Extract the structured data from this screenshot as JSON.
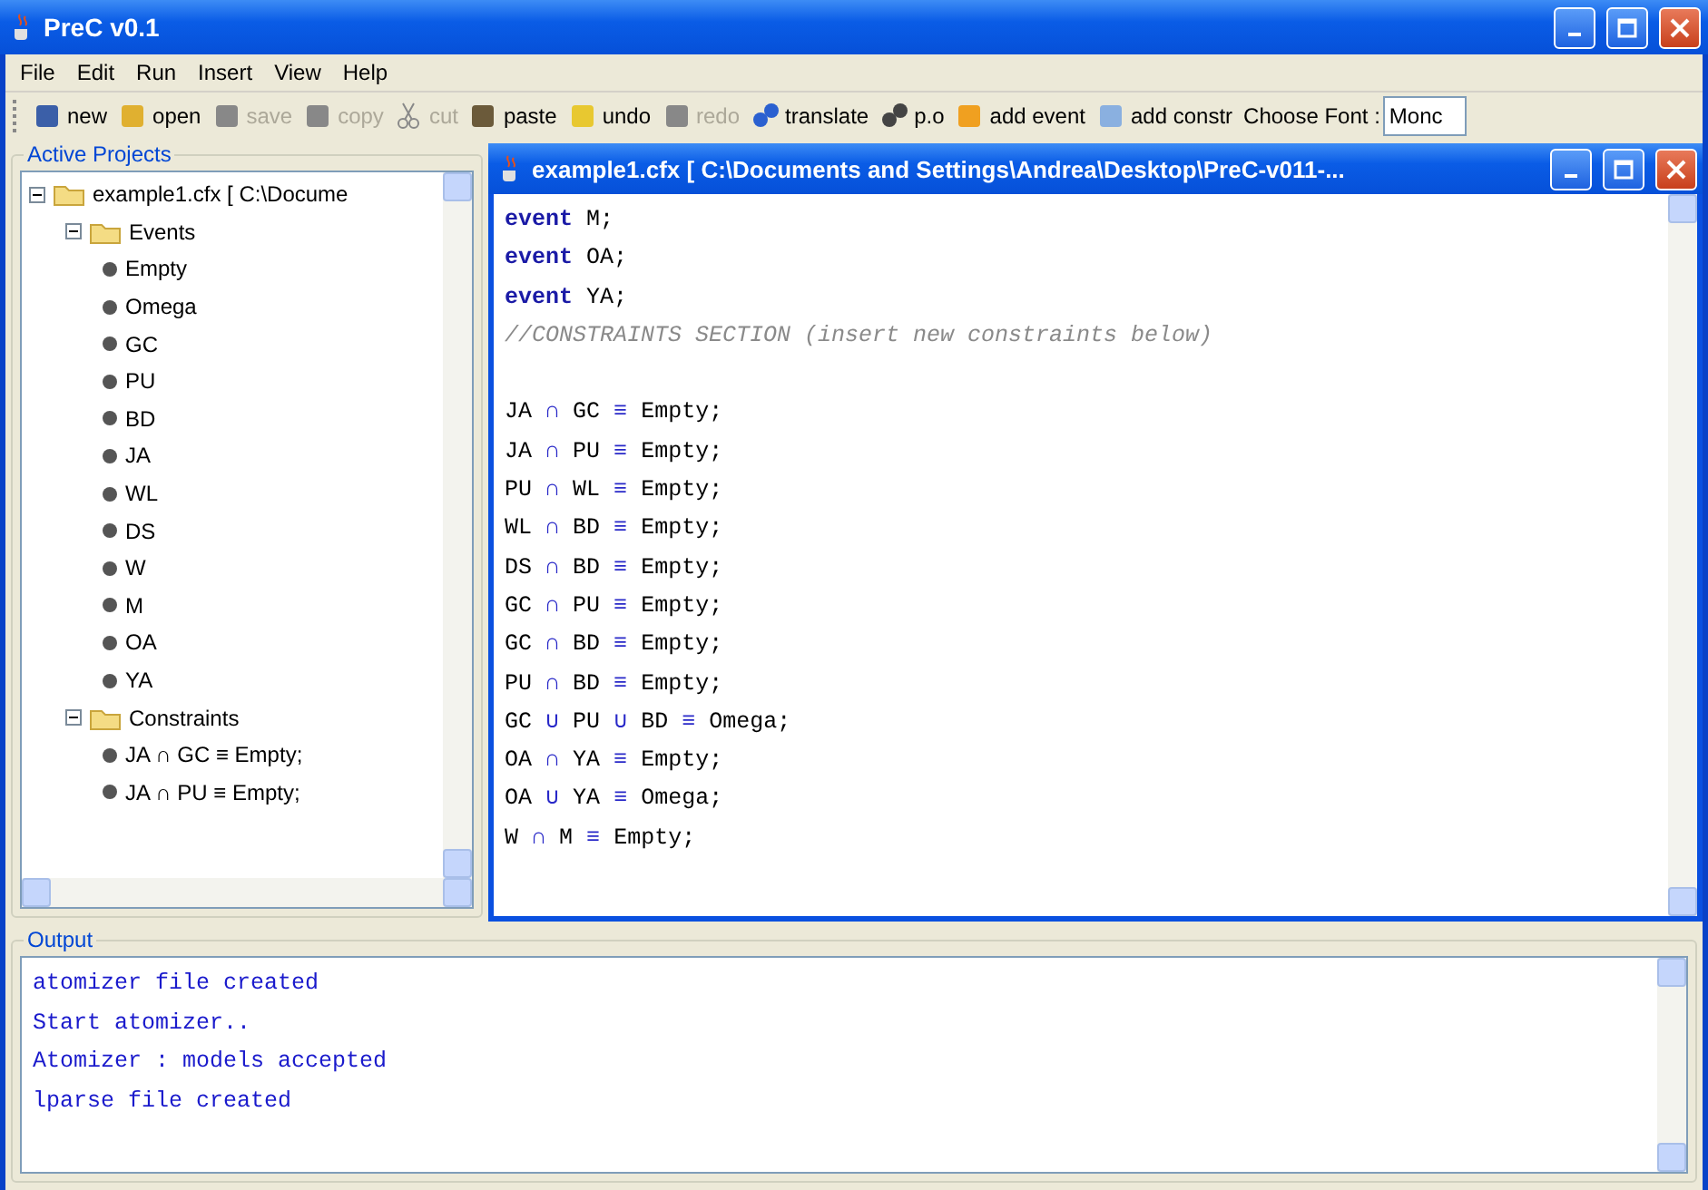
{
  "window": {
    "title": "PreC v0.1"
  },
  "menu": [
    "File",
    "Edit",
    "Run",
    "Insert",
    "View",
    "Help"
  ],
  "toolbar": [
    {
      "kind": "new",
      "label": "new",
      "disabled": false
    },
    {
      "kind": "open",
      "label": "open",
      "disabled": false
    },
    {
      "kind": "save",
      "label": "save",
      "disabled": true
    },
    {
      "kind": "copy",
      "label": "copy",
      "disabled": true
    },
    {
      "kind": "cut",
      "label": "cut",
      "disabled": true
    },
    {
      "kind": "paste",
      "label": "paste",
      "disabled": false
    },
    {
      "kind": "undo",
      "label": "undo",
      "disabled": false
    },
    {
      "kind": "redo",
      "label": "redo",
      "disabled": true
    },
    {
      "kind": "translate",
      "label": "translate",
      "disabled": false
    },
    {
      "kind": "po",
      "label": "p.o",
      "disabled": false
    },
    {
      "kind": "event",
      "label": "add event",
      "disabled": false
    },
    {
      "kind": "constr",
      "label": "add constr",
      "disabled": false
    }
  ],
  "font_chooser": {
    "label": "Choose Font :",
    "value": "Monc"
  },
  "projects": {
    "title": "Active Projects",
    "tree": [
      {
        "label": "example1.cfx [ C:\\Docume",
        "expanded": true,
        "children": [
          {
            "label": "Events",
            "expanded": true,
            "children": [
              {
                "label": "Empty"
              },
              {
                "label": "Omega"
              },
              {
                "label": "GC"
              },
              {
                "label": "PU"
              },
              {
                "label": "BD"
              },
              {
                "label": "JA"
              },
              {
                "label": "WL"
              },
              {
                "label": "DS"
              },
              {
                "label": "W"
              },
              {
                "label": "M"
              },
              {
                "label": "OA"
              },
              {
                "label": "YA"
              }
            ]
          },
          {
            "label": "Constraints",
            "expanded": true,
            "children": [
              {
                "label": "JA ∩ GC ≡ Empty;"
              },
              {
                "label": "JA ∩ PU ≡ Empty;"
              }
            ]
          }
        ]
      }
    ]
  },
  "editor": {
    "title": "example1.cfx [ C:\\Documents and Settings\\Andrea\\Desktop\\PreC-v011-...",
    "lines": [
      {
        "kind": "code",
        "tokens": [
          {
            "kind": "keyword",
            "t": "event"
          },
          {
            "kind": "plain",
            "t": " M;"
          }
        ]
      },
      {
        "kind": "code",
        "tokens": [
          {
            "kind": "keyword",
            "t": "event"
          },
          {
            "kind": "plain",
            "t": " OA;"
          }
        ]
      },
      {
        "kind": "code",
        "tokens": [
          {
            "kind": "keyword",
            "t": "event"
          },
          {
            "kind": "plain",
            "t": " YA;"
          }
        ]
      },
      {
        "kind": "code",
        "tokens": [
          {
            "kind": "comment",
            "t": "//CONSTRAINTS SECTION (insert new constraints below)"
          }
        ]
      },
      {
        "kind": "blank"
      },
      {
        "kind": "code",
        "tokens": [
          {
            "kind": "plain",
            "t": "JA "
          },
          {
            "kind": "op",
            "t": "∩"
          },
          {
            "kind": "plain",
            "t": " GC "
          },
          {
            "kind": "op",
            "t": "≡"
          },
          {
            "kind": "plain",
            "t": " Empty;"
          }
        ]
      },
      {
        "kind": "code",
        "tokens": [
          {
            "kind": "plain",
            "t": "JA "
          },
          {
            "kind": "op",
            "t": "∩"
          },
          {
            "kind": "plain",
            "t": " PU "
          },
          {
            "kind": "op",
            "t": "≡"
          },
          {
            "kind": "plain",
            "t": " Empty;"
          }
        ]
      },
      {
        "kind": "code",
        "tokens": [
          {
            "kind": "plain",
            "t": "PU "
          },
          {
            "kind": "op",
            "t": "∩"
          },
          {
            "kind": "plain",
            "t": " WL "
          },
          {
            "kind": "op",
            "t": "≡"
          },
          {
            "kind": "plain",
            "t": " Empty;"
          }
        ]
      },
      {
        "kind": "code",
        "tokens": [
          {
            "kind": "plain",
            "t": "WL "
          },
          {
            "kind": "op",
            "t": "∩"
          },
          {
            "kind": "plain",
            "t": " BD "
          },
          {
            "kind": "op",
            "t": "≡"
          },
          {
            "kind": "plain",
            "t": " Empty;"
          }
        ]
      },
      {
        "kind": "code",
        "tokens": [
          {
            "kind": "plain",
            "t": "DS "
          },
          {
            "kind": "op",
            "t": "∩"
          },
          {
            "kind": "plain",
            "t": " BD "
          },
          {
            "kind": "op",
            "t": "≡"
          },
          {
            "kind": "plain",
            "t": " Empty;"
          }
        ]
      },
      {
        "kind": "code",
        "tokens": [
          {
            "kind": "plain",
            "t": "GC "
          },
          {
            "kind": "op",
            "t": "∩"
          },
          {
            "kind": "plain",
            "t": " PU "
          },
          {
            "kind": "op",
            "t": "≡"
          },
          {
            "kind": "plain",
            "t": " Empty;"
          }
        ]
      },
      {
        "kind": "code",
        "tokens": [
          {
            "kind": "plain",
            "t": "GC "
          },
          {
            "kind": "op",
            "t": "∩"
          },
          {
            "kind": "plain",
            "t": " BD "
          },
          {
            "kind": "op",
            "t": "≡"
          },
          {
            "kind": "plain",
            "t": " Empty;"
          }
        ]
      },
      {
        "kind": "code",
        "tokens": [
          {
            "kind": "plain",
            "t": "PU "
          },
          {
            "kind": "op",
            "t": "∩"
          },
          {
            "kind": "plain",
            "t": " BD "
          },
          {
            "kind": "op",
            "t": "≡"
          },
          {
            "kind": "plain",
            "t": " Empty;"
          }
        ]
      },
      {
        "kind": "code",
        "tokens": [
          {
            "kind": "plain",
            "t": "GC "
          },
          {
            "kind": "op",
            "t": "∪"
          },
          {
            "kind": "plain",
            "t": " PU "
          },
          {
            "kind": "op",
            "t": "∪"
          },
          {
            "kind": "plain",
            "t": " BD "
          },
          {
            "kind": "op",
            "t": "≡"
          },
          {
            "kind": "plain",
            "t": " Omega;"
          }
        ]
      },
      {
        "kind": "code",
        "tokens": [
          {
            "kind": "plain",
            "t": "OA "
          },
          {
            "kind": "op",
            "t": "∩"
          },
          {
            "kind": "plain",
            "t": " YA "
          },
          {
            "kind": "op",
            "t": "≡"
          },
          {
            "kind": "plain",
            "t": " Empty;"
          }
        ]
      },
      {
        "kind": "code",
        "tokens": [
          {
            "kind": "plain",
            "t": "OA "
          },
          {
            "kind": "op",
            "t": "∪"
          },
          {
            "kind": "plain",
            "t": " YA "
          },
          {
            "kind": "op",
            "t": "≡"
          },
          {
            "kind": "plain",
            "t": " Omega;"
          }
        ]
      },
      {
        "kind": "code",
        "tokens": [
          {
            "kind": "plain",
            "t": "W "
          },
          {
            "kind": "op",
            "t": "∩"
          },
          {
            "kind": "plain",
            "t": " M "
          },
          {
            "kind": "op",
            "t": "≡"
          },
          {
            "kind": "plain",
            "t": " Empty;"
          }
        ]
      }
    ]
  },
  "output": {
    "title": "Output",
    "lines": [
      "atomizer file created",
      "Start atomizer..",
      "Atomizer : models accepted",
      "lparse file created"
    ]
  }
}
